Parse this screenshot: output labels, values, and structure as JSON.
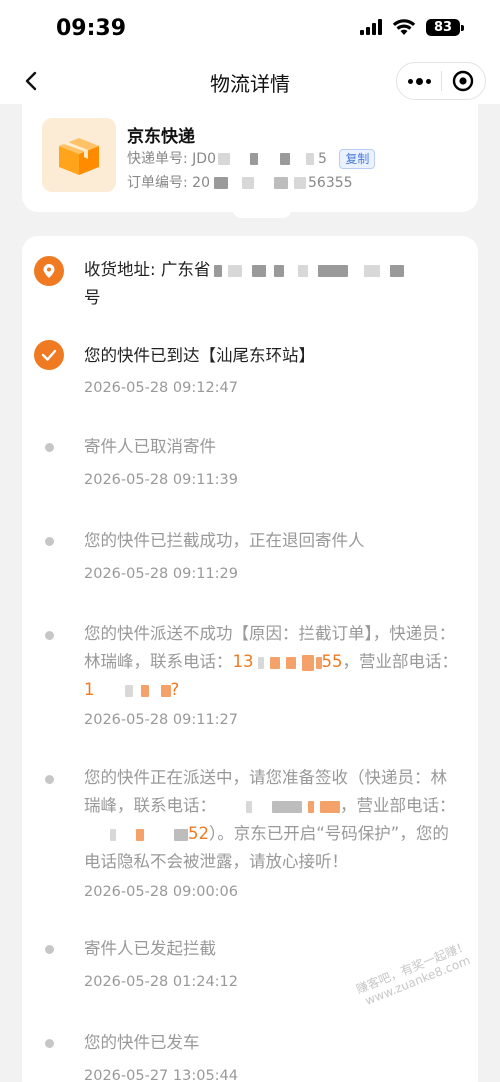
{
  "status_bar": {
    "time": "09:39",
    "battery": "83"
  },
  "nav": {
    "title": "物流详情"
  },
  "express": {
    "company": "京东快递",
    "tracking_label": "快递单号:",
    "tracking_prefix": "JD0",
    "tracking_suffix": "5",
    "copy_label": "复制",
    "order_label": "订单编号:",
    "order_prefix": "20",
    "order_suffix": "56355"
  },
  "address": {
    "label": "收货地址:",
    "province": "广东省",
    "tail": "号"
  },
  "events": [
    {
      "text": "您的快件已到达【汕尾东环站】",
      "time": "2026-05-28 09:12:47"
    },
    {
      "text": "寄件人已取消寄件",
      "time": "2026-05-28 09:11:39"
    },
    {
      "text": "您的快件已拦截成功，正在退回寄件人",
      "time": "2026-05-28 09:11:29"
    },
    {
      "text_a": "您的快件派送不成功【原因：拦截订单】，快递员：林瑞峰，联系电话：",
      "phone1_prefix": "13",
      "phone1_suffix": "55",
      "text_b": "，营业部电话：",
      "phone2_prefix": "1",
      "phone2_suffix": "?",
      "time": "2026-05-28 09:11:27"
    },
    {
      "text_a": "您的快件正在派送中，请您准备签收（快递员：林瑞峰，联系电话：",
      "text_b": "，营业部电话：",
      "phone2_suffix": "52",
      "text_c": "）。京东已开启“号码保护”，您的电话隐私不会被泄露，请放心接听！",
      "time": "2026-05-28 09:00:06"
    },
    {
      "text": "寄件人已发起拦截",
      "time": "2026-05-28 01:24:12"
    },
    {
      "text": "您的快件已发车",
      "time": "2026-05-27 13:05:44"
    }
  ],
  "watermark": "赚客吧，有奖一起赚！ www.zuanke8.com"
}
